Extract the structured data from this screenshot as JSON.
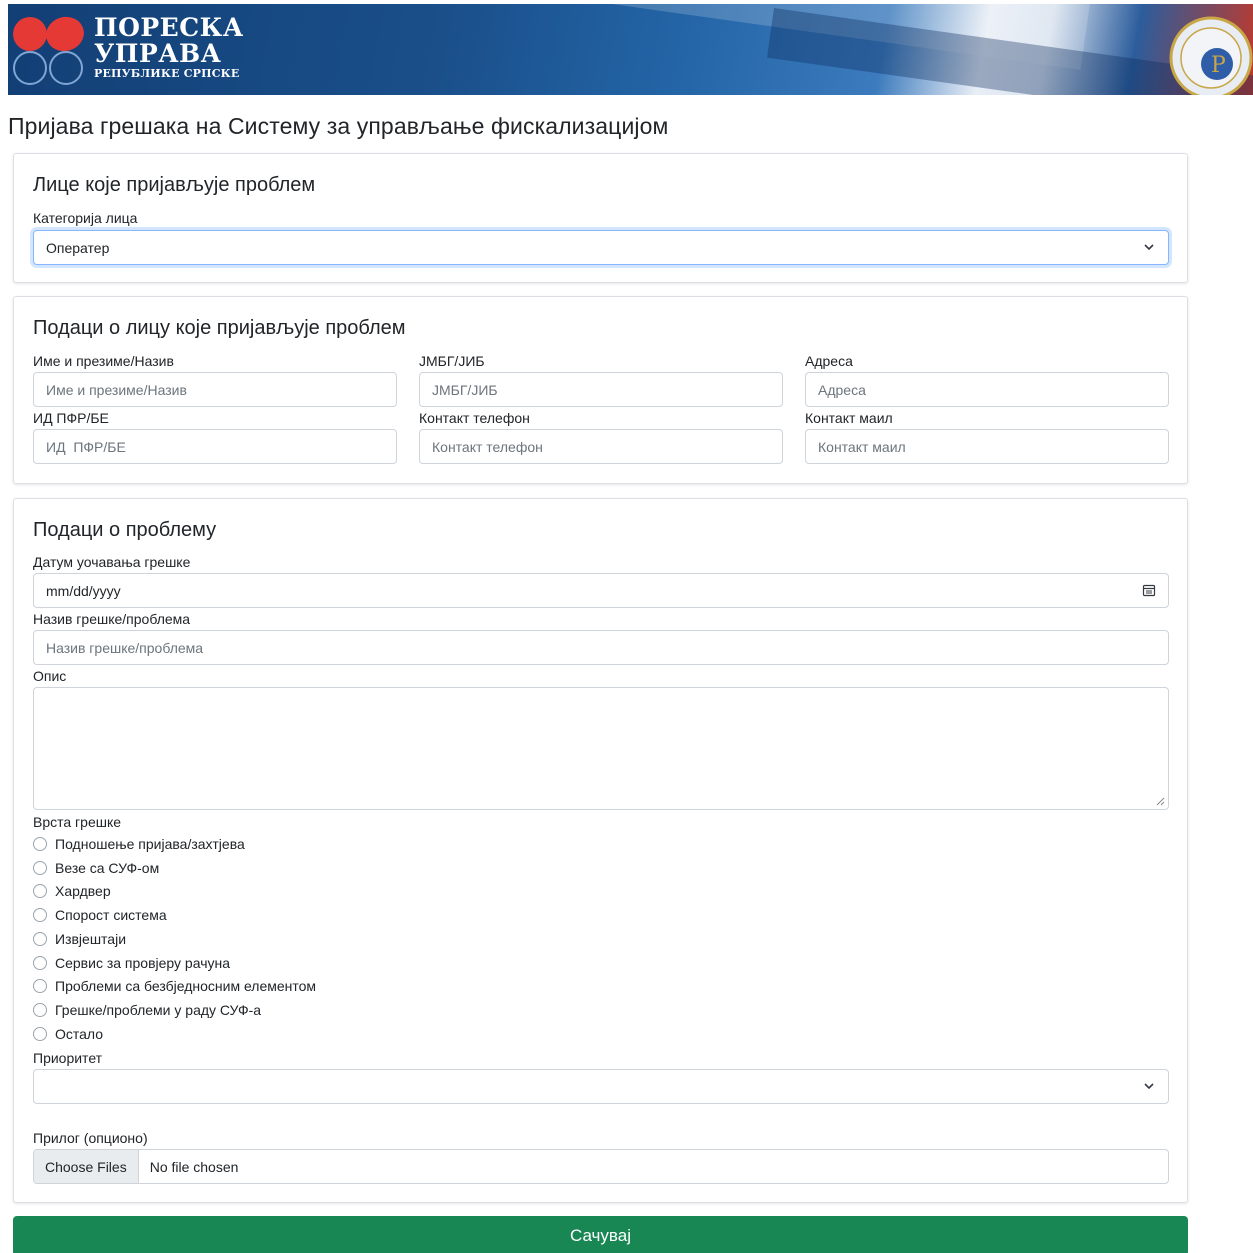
{
  "header": {
    "logo_line1": "ПОРЕСКА",
    "logo_line2": "УПРАВА",
    "logo_line3": "РЕПУБЛИКЕ СРПСКЕ"
  },
  "page_title": "Пријава грешака на Систему за управљање фискализацијом",
  "section_reporter": {
    "heading": "Лице које пријављује проблем",
    "category_label": "Категорија лица",
    "category_value": "Оператер"
  },
  "section_person": {
    "heading": "Подаци о лицу које пријављује проблем",
    "name_label": "Име и презиме/Назив",
    "name_placeholder": "Име и презиме/Назив",
    "jmbg_label": "ЈМБГ/ЈИБ",
    "jmbg_placeholder": "ЈМБГ/ЈИБ",
    "address_label": "Адреса",
    "address_placeholder": "Адреса",
    "pfr_label": "ИД ПФР/БЕ",
    "pfr_placeholder": "ИД  ПФР/БЕ",
    "phone_label": "Контакт телефон",
    "phone_placeholder": "Контакт телефон",
    "mail_label": "Контакт маил",
    "mail_placeholder": "Контакт маил"
  },
  "section_problem": {
    "heading": "Подаци о проблему",
    "date_label": "Датум уочавања грешке",
    "date_placeholder": "mm/dd/yyyy",
    "title_label": "Назив грешке/проблема",
    "title_placeholder": "Назив грешке/проблема",
    "desc_label": "Опис",
    "type_label": "Врста грешке",
    "types": [
      "Подношење пријава/захтјева",
      "Везе са СУФ-ом",
      "Хардвер",
      "Спорост система",
      "Извјештаји",
      "Сервис за провјеру рачуна",
      "Проблеми са безбједносним елементом",
      "Грешке/проблеми у раду СУФ-а",
      "Остало"
    ],
    "priority_label": "Приоритет",
    "priority_value": "",
    "attachment_label": "Прилог (опционо)",
    "choose_files": "Choose Files",
    "no_file": "No file chosen"
  },
  "save_label": "Сачувај",
  "colors": {
    "primary_green": "#198754",
    "banner_blue": "#1a4f8a",
    "focus_border": "#86b7fe"
  }
}
